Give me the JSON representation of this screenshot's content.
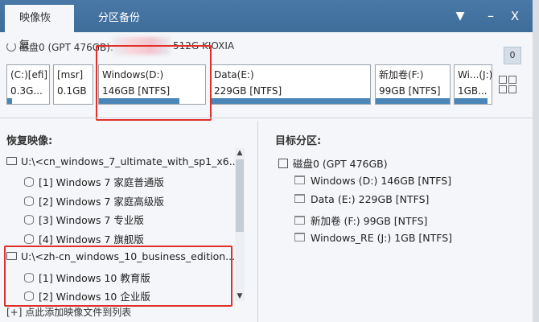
{
  "tabs": [
    {
      "label": "映像恢复",
      "active": true
    },
    {
      "label": "分区备份",
      "active": false
    }
  ],
  "titlebar": {
    "dropdown_icon": "▼",
    "minimize_icon": "–",
    "close_icon": "X"
  },
  "disk": {
    "label": "磁盘0 (GPT 476GB): K",
    "model": "512G KIOXIA",
    "badge": "0"
  },
  "partitions": [
    {
      "name": "(C:)[efi]",
      "size": "0.3G...",
      "usage": 0.12
    },
    {
      "name": "[msr]",
      "size": "0.1GB",
      "usage": 0.0
    },
    {
      "name": "Windows(D:)",
      "size": "146GB [NTFS]",
      "usage": 0.76
    },
    {
      "name": "Data(E:)",
      "size": "229GB [NTFS]",
      "usage": 1.0
    },
    {
      "name": "新加卷(F:)",
      "size": "99GB [NTFS]",
      "usage": 1.0
    },
    {
      "name": "Wi...(J:)",
      "size": "1GB...",
      "usage": 0.9
    }
  ],
  "left": {
    "title": "恢复映像:",
    "images": [
      {
        "path": "U:\\<cn_windows_7_ultimate_with_sp1_x6...",
        "editions": [
          "[1] Windows 7 家庭普通版",
          "[2] Windows 7 家庭高级版",
          "[3] Windows 7 专业版",
          "[4] Windows 7 旗舰版"
        ]
      },
      {
        "path": "U:\\<zh-cn_windows_10_business_edition...",
        "editions": [
          "[1] Windows 10 教育版",
          "[2] Windows 10 企业版"
        ]
      }
    ],
    "add_link": "[+] 点此添加映像文件到列表"
  },
  "right": {
    "title": "目标分区:",
    "disk": "磁盘0 (GPT 476GB)",
    "partitions": [
      "Windows (D:) 146GB [NTFS]",
      "Data (E:) 229GB [NTFS]",
      "新加卷 (F:) 99GB [NTFS]",
      "Windows_RE (J:) 1GB [NTFS]"
    ]
  },
  "colors": {
    "titlebar": "#4a78a6",
    "bar": "#4b86b8",
    "highlight": "#e0302a"
  }
}
